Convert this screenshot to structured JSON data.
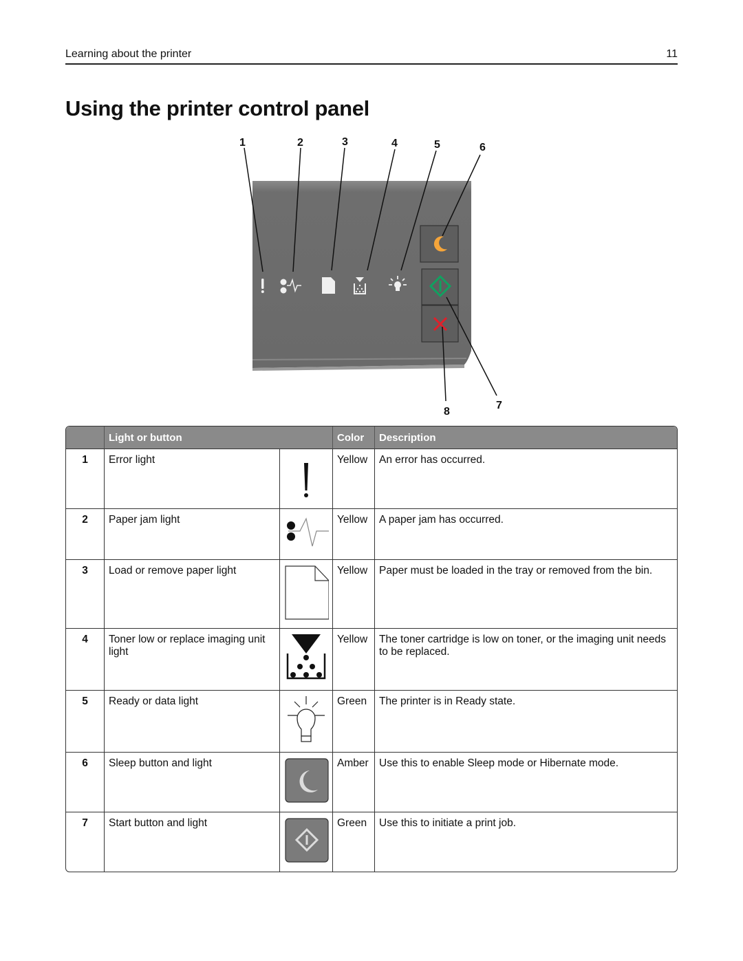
{
  "header": {
    "section": "Learning about the printer",
    "page_number": "11"
  },
  "title": "Using the printer control panel",
  "figure": {
    "callouts": [
      "1",
      "2",
      "3",
      "4",
      "5",
      "6",
      "7",
      "8"
    ],
    "colors": {
      "panel": "#6f6f6f",
      "sleep": "#f5a53a",
      "start": "#12a060",
      "stop": "#e0202a",
      "icon_light": "#f0f0f0"
    }
  },
  "table": {
    "headers": [
      "",
      "Light or button",
      "Color",
      "Description"
    ],
    "rows": [
      {
        "num": "1",
        "name": "Error light",
        "icon": "exclamation-icon",
        "color": "Yellow",
        "description": "An error has occurred."
      },
      {
        "num": "2",
        "name": "Paper jam light",
        "icon": "paper-jam-icon",
        "color": "Yellow",
        "description": "A paper jam has occurred."
      },
      {
        "num": "3",
        "name": "Load or remove paper light",
        "icon": "paper-icon",
        "color": "Yellow",
        "description": "Paper must be loaded in the tray or removed from the bin."
      },
      {
        "num": "4",
        "name": "Toner low or replace imaging unit light",
        "icon": "toner-icon",
        "color": "Yellow",
        "description": "The toner cartridge is low on toner, or the imaging unit needs to be replaced."
      },
      {
        "num": "5",
        "name": "Ready or data light",
        "icon": "lightbulb-icon",
        "color": "Green",
        "description": "The printer is in Ready state."
      },
      {
        "num": "6",
        "name": "Sleep button and light",
        "icon": "sleep-moon-icon",
        "color": "Amber",
        "description": "Use this to enable Sleep mode or Hibernate mode."
      },
      {
        "num": "7",
        "name": "Start button and light",
        "icon": "start-diamond-icon",
        "color": "Green",
        "description": "Use this to initiate a print job."
      }
    ]
  }
}
